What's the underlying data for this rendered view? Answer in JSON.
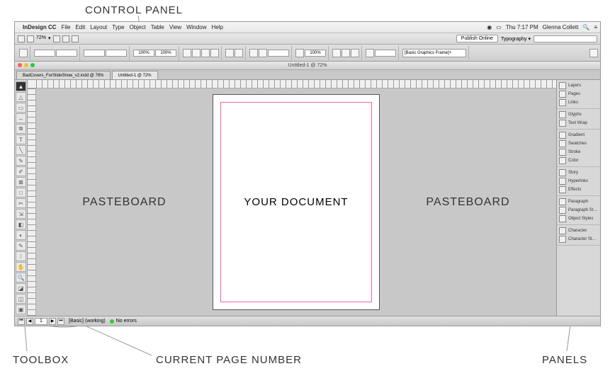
{
  "annotations": {
    "control_panel": "CONTROL PANEL",
    "toolbox": "TOOLBOX",
    "page_number": "CURRENT PAGE NUMBER",
    "panels": "PANELS"
  },
  "menubar": {
    "apple": "",
    "app": "InDesign CC",
    "items": [
      "File",
      "Edit",
      "Layout",
      "Type",
      "Object",
      "Table",
      "View",
      "Window",
      "Help"
    ],
    "right_time": "Thu 7:17 PM",
    "right_user": "Glenna Collett"
  },
  "subbar": {
    "zoom": "72%",
    "publish": "Publish Online",
    "workspace": "Typography",
    "search_placeholder": ""
  },
  "control": {
    "frame_style": "[Basic Graphics Frame]+",
    "pct": "100%",
    "pct2": "100%"
  },
  "window": {
    "title": "Untitled-1 @ 72%"
  },
  "tabs": [
    {
      "label": "BadCovers_ForSlideShow_v2.indd @ 76%",
      "active": false
    },
    {
      "label": "Untitled-1 @ 72%",
      "active": true
    }
  ],
  "canvas": {
    "left_label": "PASTEBOARD",
    "doc_label": "YOUR DOCUMENT",
    "right_label": "PASTEBOARD"
  },
  "panels": [
    {
      "items": [
        "Layers",
        "Pages",
        "Links"
      ]
    },
    {
      "items": [
        "Glyphs",
        "Text Wrap"
      ]
    },
    {
      "items": [
        "Gradient",
        "Swatches",
        "Stroke",
        "Color"
      ]
    },
    {
      "items": [
        "Story",
        "Hyperlinks",
        "Effects"
      ]
    },
    {
      "items": [
        "Paragraph",
        "Paragraph St…",
        "Object Styles"
      ]
    },
    {
      "items": [
        "Character",
        "Character St…"
      ]
    }
  ],
  "panel_icons": {
    "Layers": "layers-icon",
    "Pages": "pages-icon",
    "Links": "links-icon",
    "Glyphs": "glyphs-icon",
    "Text Wrap": "text-wrap-icon",
    "Gradient": "gradient-icon",
    "Swatches": "swatches-icon",
    "Stroke": "stroke-icon",
    "Color": "color-icon",
    "Story": "story-icon",
    "Hyperlinks": "hyperlinks-icon",
    "Effects": "effects-icon",
    "Paragraph": "paragraph-icon",
    "Paragraph St…": "paragraph-styles-icon",
    "Object Styles": "object-styles-icon",
    "Character": "character-icon",
    "Character St…": "character-styles-icon"
  },
  "status": {
    "page": "1",
    "master": "[Basic] (working)",
    "preflight": "No errors"
  },
  "tools": [
    "selection",
    "direct-selection",
    "page",
    "gap",
    "content-collector",
    "type",
    "line",
    "pen",
    "pencil",
    "rectangle-frame",
    "rectangle",
    "scissors",
    "free-transform",
    "gradient-swatch",
    "gradient-feather",
    "note",
    "eyedropper",
    "hand",
    "zoom",
    "fill-stroke",
    "default-fill-stroke",
    "view-mode"
  ]
}
